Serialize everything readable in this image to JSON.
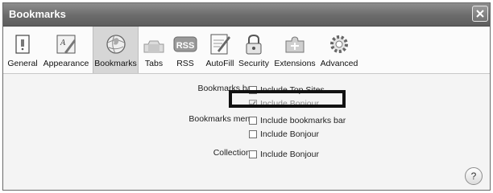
{
  "window": {
    "title": "Bookmarks"
  },
  "toolbar": {
    "items": [
      {
        "label": "General",
        "icon": "general-switch-icon"
      },
      {
        "label": "Appearance",
        "icon": "appearance-font-icon"
      },
      {
        "label": "Bookmarks",
        "icon": "bookmarks-globe-icon",
        "selected": true
      },
      {
        "label": "Tabs",
        "icon": "tabs-icon"
      },
      {
        "label": "RSS",
        "icon": "rss-icon",
        "badge": "RSS"
      },
      {
        "label": "AutoFill",
        "icon": "autofill-pencil-icon"
      },
      {
        "label": "Security",
        "icon": "security-lock-icon"
      },
      {
        "label": "Extensions",
        "icon": "extensions-puzzle-icon"
      },
      {
        "label": "Advanced",
        "icon": "advanced-gear-icon"
      }
    ]
  },
  "settings": {
    "bookmarks_bar": {
      "label": "Bookmarks bar:",
      "options": [
        {
          "text": "Include Top Sites",
          "checked": false,
          "enabled": true
        },
        {
          "text": "Include Bonjour",
          "checked": true,
          "enabled": false
        }
      ]
    },
    "bookmarks_menu": {
      "label": "Bookmarks menu:",
      "options": [
        {
          "text": "Include bookmarks bar",
          "checked": false,
          "enabled": true
        },
        {
          "text": "Include Bonjour",
          "checked": false,
          "enabled": true
        }
      ]
    },
    "collections": {
      "label": "Collections:",
      "options": [
        {
          "text": "Include Bonjour",
          "checked": false,
          "enabled": true
        }
      ]
    }
  },
  "help": {
    "label": "?"
  }
}
